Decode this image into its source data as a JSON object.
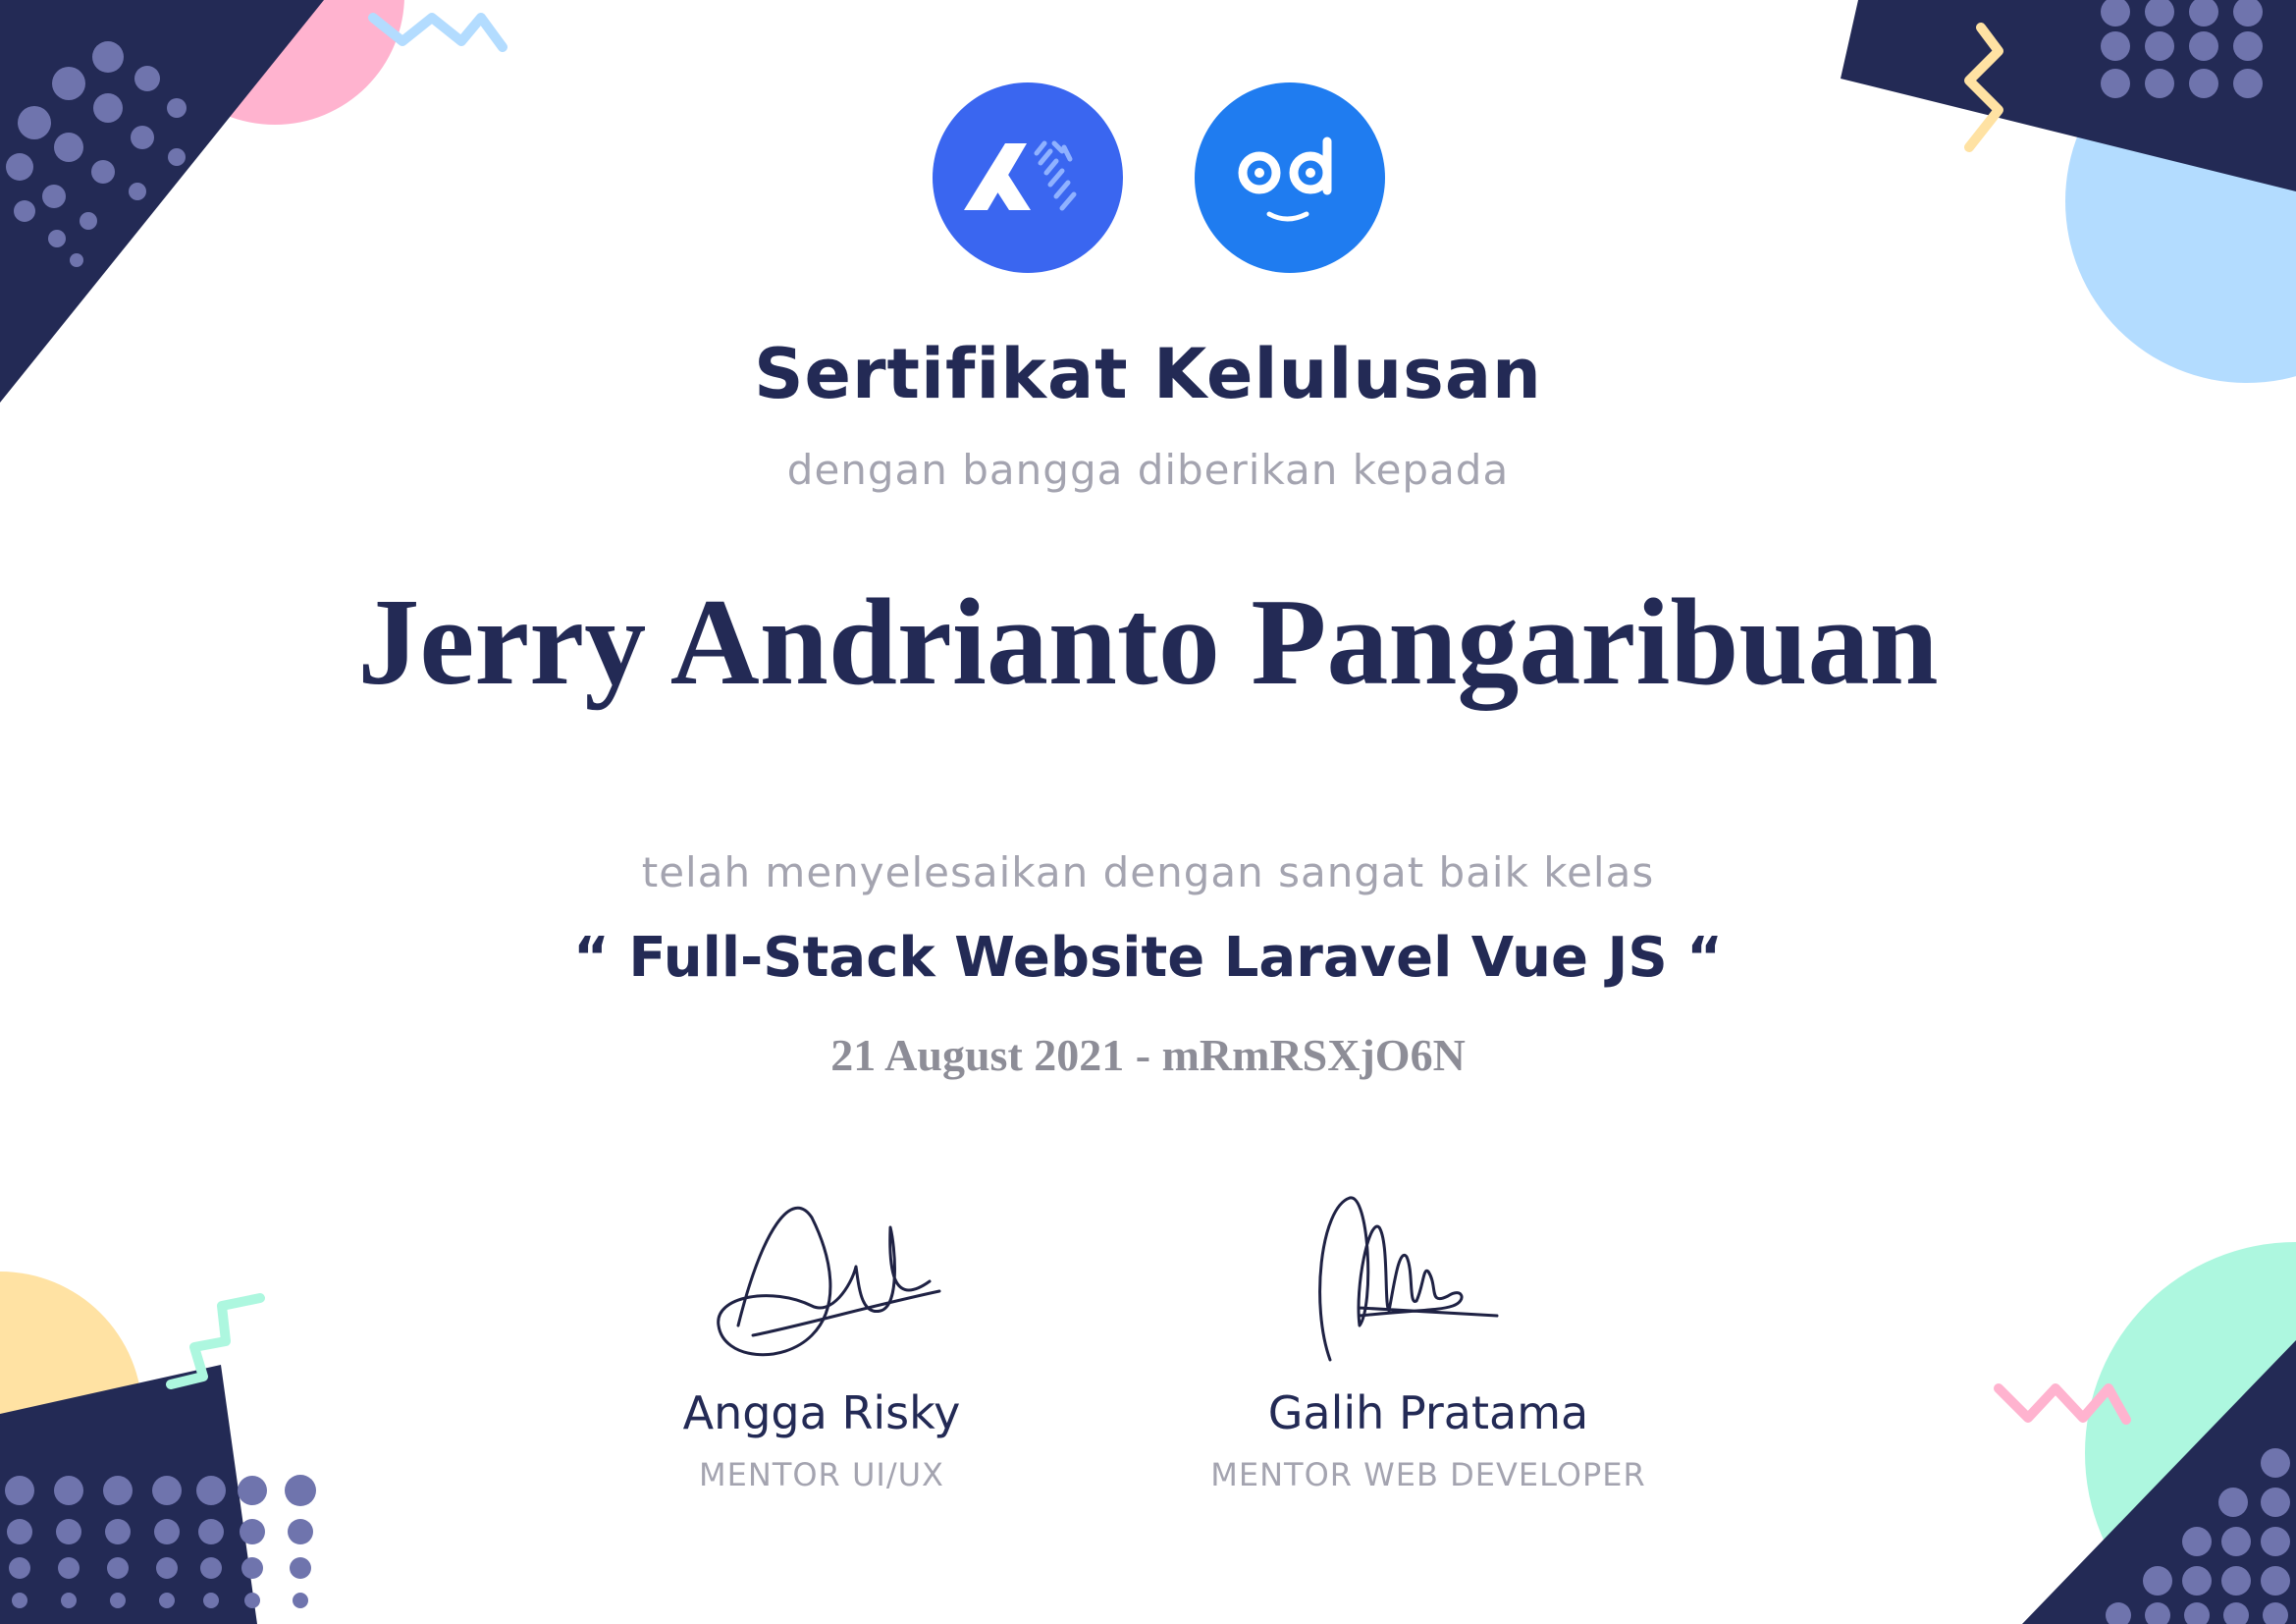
{
  "certificate": {
    "title": "Sertifikat Kelulusan",
    "subtitle": "dengan bangga diberikan kepada",
    "recipient": "Jerry Andrianto Pangaribuan",
    "completion_text": "telah menyelesaikan dengan sangat baik kelas",
    "course": "“ Full-Stack Website Laravel Vue JS “",
    "date_code": "21 August 2021 - mRmRSXjO6N"
  },
  "signatories": [
    {
      "name": "Angga Risky",
      "role": "MENTOR UI/UX"
    },
    {
      "name": "Galih Pratama",
      "role": "MENTOR WEB DEVELOPER"
    }
  ],
  "logos": [
    {
      "icon": "buildwithangga-logo-icon",
      "color": "#3a66f0"
    },
    {
      "icon": "odevtalk-logo-icon",
      "color": "#1f7cf0"
    }
  ],
  "colors": {
    "navy": "#232a55",
    "gray_text": "#a4a4b0",
    "pink": "#ffb3cf",
    "light_blue": "#b3dcff",
    "yellow": "#ffe2a3",
    "mint": "#adf7df",
    "dots": "#6f74ad"
  }
}
